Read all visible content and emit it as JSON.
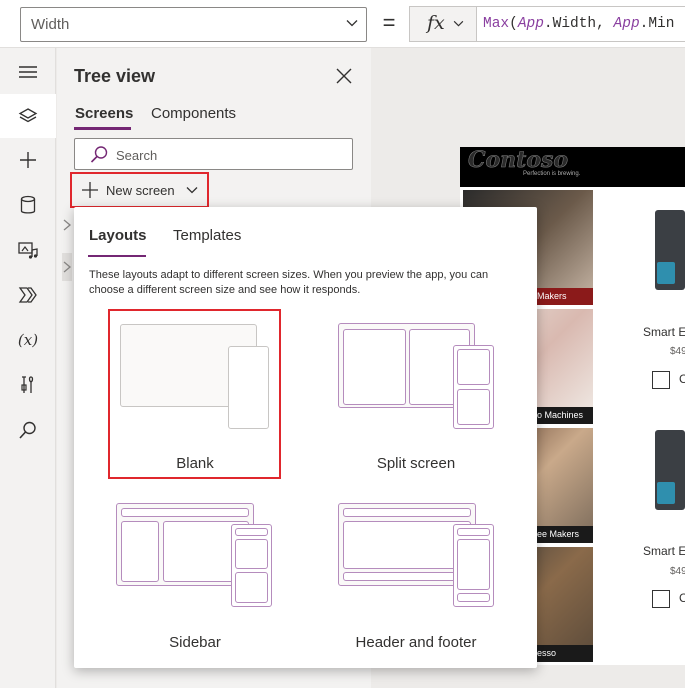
{
  "formula_bar": {
    "property": "Width",
    "equals": "=",
    "fx_label": "fx",
    "formula_tokens": [
      {
        "text": "Max",
        "cls": "fn"
      },
      {
        "text": "(",
        "cls": "pun"
      },
      {
        "text": "App",
        "cls": "obj"
      },
      {
        "text": ".Width, ",
        "cls": "prp"
      },
      {
        "text": "App",
        "cls": "obj"
      },
      {
        "text": ".Min",
        "cls": "prp"
      }
    ]
  },
  "rail": {
    "icons": [
      "hamburger-icon",
      "layers-icon",
      "plus-icon",
      "database-icon",
      "media-icon",
      "power-automate-icon",
      "variables-icon",
      "tools-icon",
      "search-icon"
    ],
    "variables_label": "(x)"
  },
  "tree": {
    "title": "Tree view",
    "tabs": [
      "Screens",
      "Components"
    ],
    "active_tab": "Screens",
    "search_placeholder": "Search",
    "new_screen_label": "New screen"
  },
  "popup": {
    "tabs": [
      "Layouts",
      "Templates"
    ],
    "active_tab": "Layouts",
    "description": "These layouts adapt to different screen sizes. When you preview the app, you can choose a different screen size and see how it responds.",
    "layouts": [
      {
        "label": "Blank"
      },
      {
        "label": "Split screen"
      },
      {
        "label": "Sidebar"
      },
      {
        "label": "Header and footer"
      }
    ]
  },
  "canvas_app": {
    "logo": "Contoso",
    "tagline": "Perfection is brewing.",
    "categories": [
      "Makers",
      "o Machines",
      "ee Makers",
      "esso"
    ],
    "products": [
      {
        "name": "Smart E",
        "price": "$49",
        "check": "C"
      },
      {
        "name": "Smart E",
        "price": "$49",
        "check": "C"
      }
    ]
  },
  "colors": {
    "accent": "#742774",
    "highlight_red": "#e0272d",
    "rail_bg": "#f3f2f1"
  }
}
